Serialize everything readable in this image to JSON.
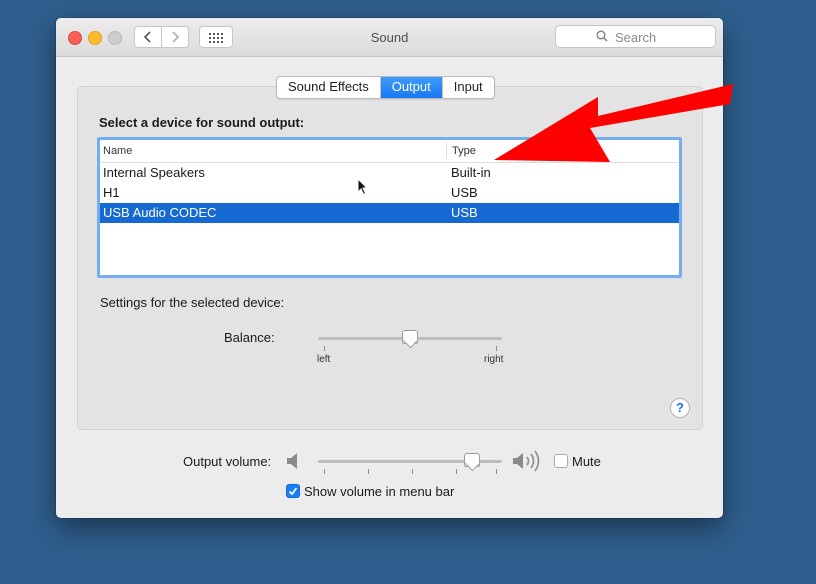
{
  "window": {
    "title": "Sound",
    "search_placeholder": "Search"
  },
  "tabs": [
    {
      "label": "Sound Effects",
      "active": false
    },
    {
      "label": "Output",
      "active": true
    },
    {
      "label": "Input",
      "active": false
    }
  ],
  "output": {
    "select_label": "Select a device for sound output:",
    "columns": {
      "name": "Name",
      "type": "Type"
    },
    "devices": [
      {
        "name": "Internal Speakers",
        "type": "Built-in",
        "selected": false
      },
      {
        "name": "H1",
        "type": "USB",
        "selected": false
      },
      {
        "name": "USB Audio CODEC",
        "type": "USB",
        "selected": true
      }
    ],
    "settings_label": "Settings for the selected device:",
    "balance": {
      "label": "Balance:",
      "left_label": "left",
      "right_label": "right",
      "value": 0.5
    },
    "help_label": "?"
  },
  "volume": {
    "label": "Output volume:",
    "value": 0.86,
    "mute_label": "Mute",
    "mute_checked": false,
    "menu_bar_label": "Show volume in menu bar",
    "menu_bar_checked": true
  },
  "colors": {
    "desktop": "#2f5f8e",
    "accent": "#1778f2",
    "selection": "#1569d1",
    "annotation_arrow": "#ff0000"
  },
  "icons": [
    "chevron-left-icon",
    "chevron-right-icon",
    "grid-icon",
    "search-icon",
    "speaker-low-icon",
    "speaker-high-icon",
    "question-icon",
    "checkmark-icon",
    "mouse-cursor-icon",
    "red-arrow-annotation"
  ]
}
